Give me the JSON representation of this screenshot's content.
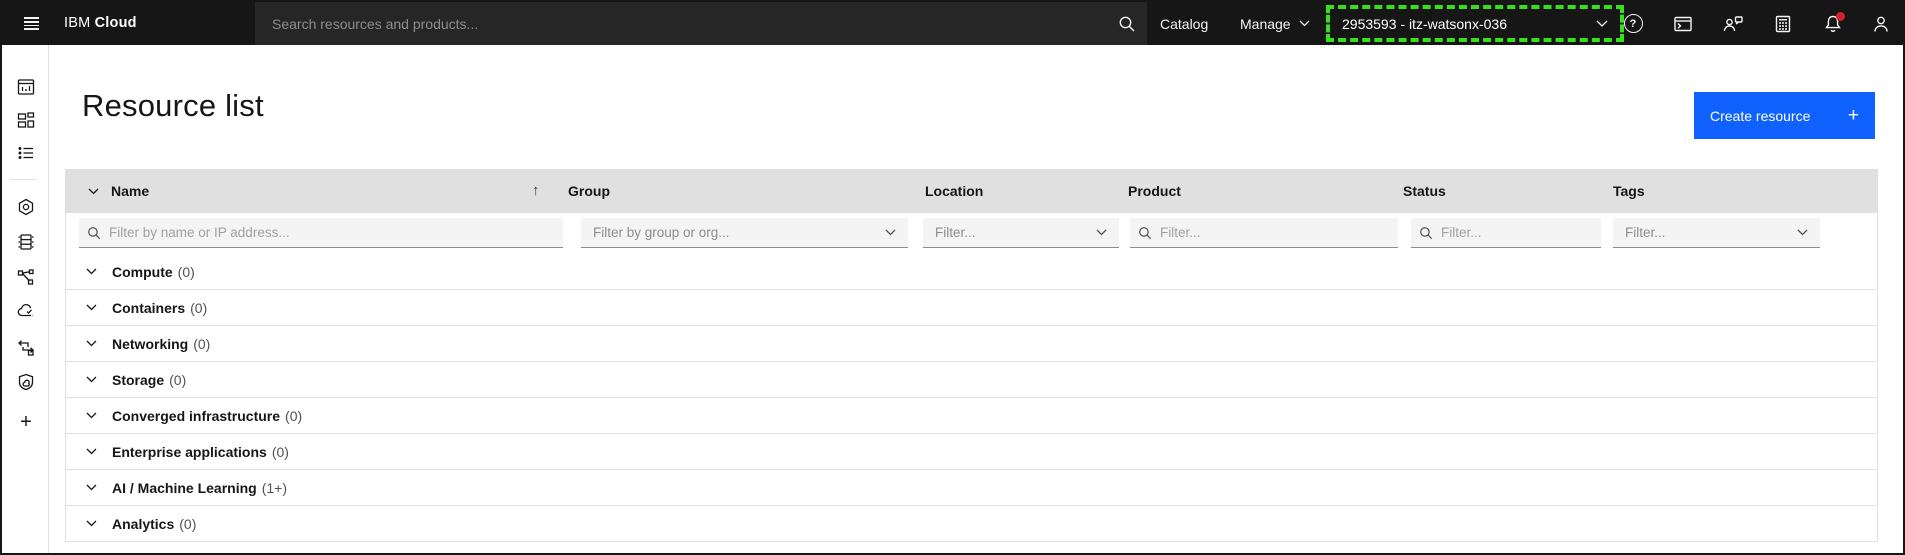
{
  "colors": {
    "accent_blue": "#0f62fe",
    "header_bg": "#161616",
    "annotation_green": "#38df1d",
    "notification_red": "#da1e28",
    "table_header_bg": "#e0e0e0"
  },
  "header": {
    "brand_ibm": "IBM",
    "brand_cloud": "Cloud",
    "search_placeholder": "Search resources and products...",
    "nav_catalog": "Catalog",
    "nav_manage": "Manage",
    "account_selector": "2953593 - itz-watsonx-036",
    "help_glyph": "?",
    "icons": [
      "help-icon",
      "cloud-shell-icon",
      "feedback-icon",
      "cost-estimator-icon",
      "notifications-icon",
      "avatar-icon"
    ]
  },
  "sidebar": {
    "icons": [
      "dashboard-icon",
      "apps-icon",
      "resource-list-icon",
      "infrastructure-icon",
      "vpc-servers-icon",
      "schematics-icon",
      "cloud-satellite-icon",
      "migration-icon",
      "security-shield-icon",
      "add-icon"
    ],
    "add_glyph": "+"
  },
  "page": {
    "title": "Resource list",
    "create_button": {
      "label": "Create resource",
      "plus": "+"
    }
  },
  "table": {
    "sort_arrow": "↑",
    "columns": [
      "Name",
      "Group",
      "Location",
      "Product",
      "Status",
      "Tags"
    ],
    "filters": {
      "name": {
        "type": "search",
        "placeholder": "Filter by name or IP address..."
      },
      "group": {
        "type": "dropdown",
        "placeholder": "Filter by group or org..."
      },
      "location": {
        "type": "dropdown",
        "placeholder": "Filter..."
      },
      "product": {
        "type": "search",
        "placeholder": "Filter..."
      },
      "status": {
        "type": "search",
        "placeholder": "Filter..."
      },
      "tags": {
        "type": "dropdown",
        "placeholder": "Filter..."
      }
    },
    "groups": [
      {
        "label": "Compute",
        "count": "(0)"
      },
      {
        "label": "Containers",
        "count": "(0)"
      },
      {
        "label": "Networking",
        "count": "(0)"
      },
      {
        "label": "Storage",
        "count": "(0)"
      },
      {
        "label": "Converged infrastructure",
        "count": "(0)"
      },
      {
        "label": "Enterprise applications",
        "count": "(0)"
      },
      {
        "label": "AI / Machine Learning",
        "count": "(1+)"
      },
      {
        "label": "Analytics",
        "count": "(0)"
      }
    ]
  }
}
